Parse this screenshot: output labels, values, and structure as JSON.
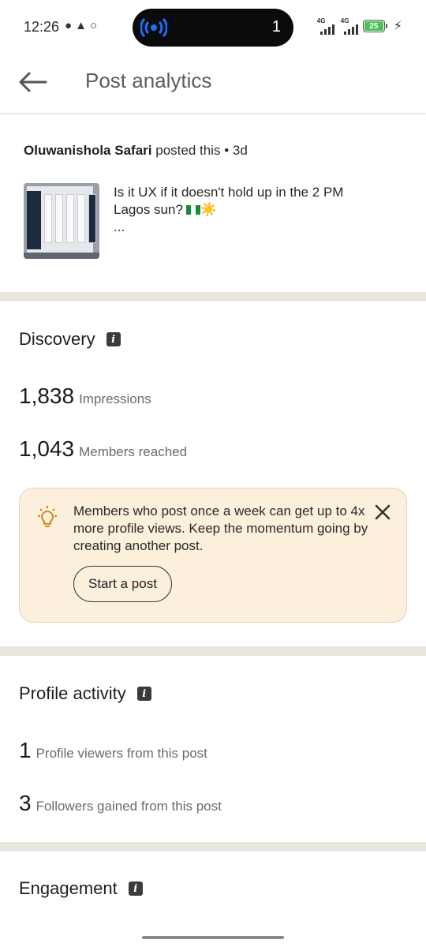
{
  "status_bar": {
    "time": "12:26",
    "notification_icons": [
      "chat-bubble-icon",
      "snapchat-icon",
      "whatsapp-icon"
    ],
    "island_count": "1",
    "network_1": "4G",
    "network_2": "4G",
    "battery_level": "25",
    "battery_color": "#4cc159"
  },
  "header": {
    "title": "Post analytics"
  },
  "post": {
    "author": "Oluwanishola Safari",
    "action": "posted this",
    "time": "• 3d",
    "text_line_1": "Is it UX if it doesn't hold up in the 2 PM",
    "text_line_2": "Lagos sun?",
    "sun_emoji": "☀️",
    "ellipsis": "..."
  },
  "discovery": {
    "title": "Discovery",
    "impressions_value": "1,838",
    "impressions_label": "Impressions",
    "reached_value": "1,043",
    "reached_label": "Members reached",
    "tip_text": "Members who post once a week can get up to 4x more profile views. Keep the momentum going by creating another post.",
    "tip_button": "Start a post"
  },
  "profile_activity": {
    "title": "Profile activity",
    "viewers_value": "1",
    "viewers_label": "Profile viewers from this post",
    "followers_value": "3",
    "followers_label": "Followers gained from this post"
  },
  "engagement": {
    "title": "Engagement"
  },
  "colors": {
    "tip_background": "#fcefdc",
    "divider": "#e9e6df",
    "accent_signal": "#1e6fff"
  }
}
